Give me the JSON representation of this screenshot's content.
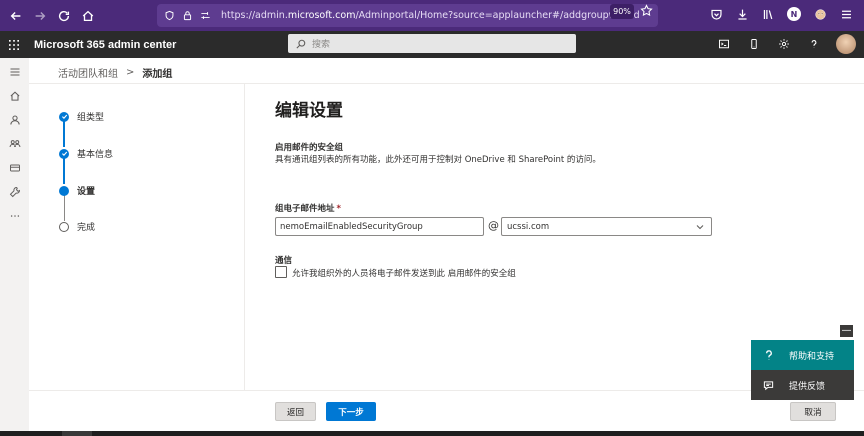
{
  "browser": {
    "url_prefix": "https://admin.",
    "url_domain": "microsoft.com",
    "url_path": "/Adminportal/Home?source=applauncher#/addgroupwizard",
    "zoom": "90%",
    "profile_initial": "N"
  },
  "header": {
    "app_title": "Microsoft 365 admin center",
    "search_placeholder": "搜索"
  },
  "breadcrumb": {
    "parent": "活动团队和组",
    "separator": ">",
    "current": "添加组"
  },
  "wizard": {
    "steps": [
      {
        "label": "组类型",
        "state": "completed"
      },
      {
        "label": "基本信息",
        "state": "completed"
      },
      {
        "label": "设置",
        "state": "current"
      },
      {
        "label": "完成",
        "state": "pending"
      }
    ]
  },
  "main": {
    "title": "编辑设置",
    "section_title": "启用邮件的安全组",
    "section_desc": "具有通讯组列表的所有功能，此外还可用于控制对 OneDrive 和 SharePoint 的访问。",
    "email_label": "组电子邮件地址",
    "required_mark": "*",
    "email_value": "nemoEmailEnabledSecurityGroup",
    "at_symbol": "@",
    "domain_value": "ucssi.com",
    "comm_title": "通信",
    "checkbox_label": "允许我组织外的人员将电子邮件发送到此 启用邮件的安全组",
    "checkbox_checked": false
  },
  "footer": {
    "back_label": "返回",
    "next_label": "下一步",
    "cancel_label": "取消"
  },
  "help_panel": {
    "collapse": "—",
    "help_label": "帮助和支持",
    "feedback_label": "提供反馈"
  },
  "colors": {
    "browser_bar": "#4b2a7a",
    "header": "#2b2b2b",
    "accent": "#0078d4",
    "help": "#038387"
  }
}
